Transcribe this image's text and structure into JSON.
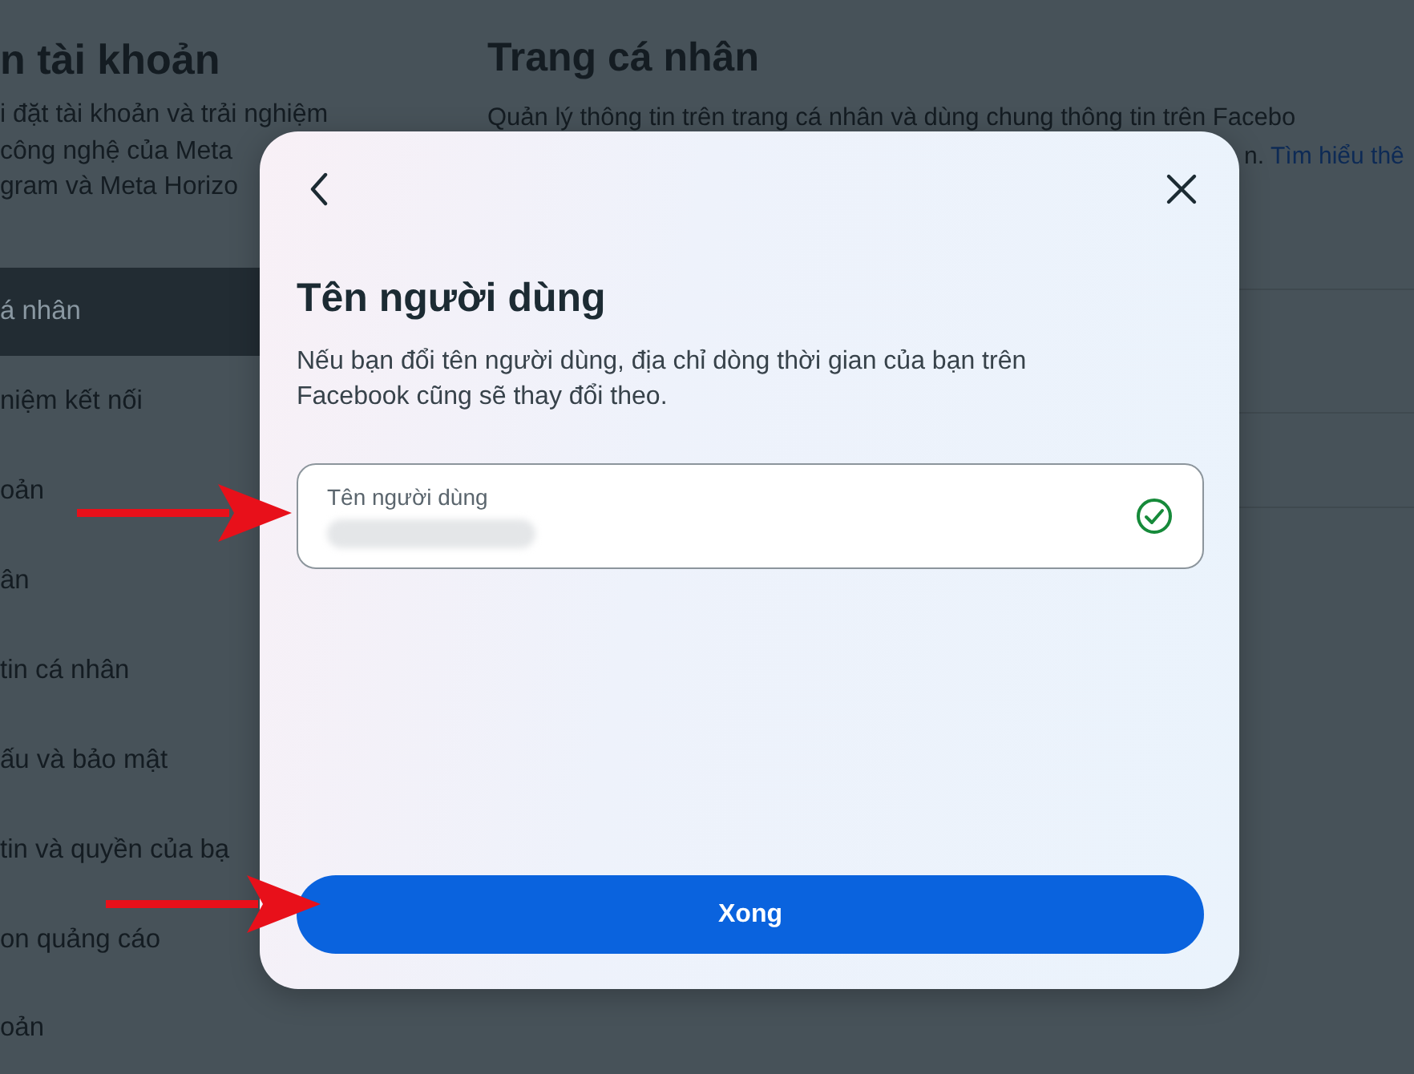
{
  "background": {
    "sidebar": {
      "title": "n tài khoản",
      "description_lines": [
        "i đặt tài khoản và trải nghiệm",
        "công nghệ của Meta",
        "gram và Meta Horizo"
      ],
      "items": [
        {
          "label": "á nhân",
          "selected": true
        },
        {
          "label": "niệm kết nối",
          "selected": false
        },
        {
          "label": "oản",
          "selected": false
        },
        {
          "label": "ân",
          "selected": false
        },
        {
          "label": "tin cá nhân",
          "selected": false
        },
        {
          "label": "ấu và bảo mật",
          "selected": false
        },
        {
          "label": "tin và quyền của bạ",
          "selected": false
        },
        {
          "label": "on quảng cáo",
          "selected": false
        },
        {
          "label": "oản",
          "selected": false
        }
      ]
    },
    "main": {
      "title": "Trang cá nhân",
      "description": "Quản lý thông tin trên trang cá nhân và dùng chung thông tin trên Facebo",
      "description_end": "n.",
      "link": "Tìm hiểu thê"
    }
  },
  "dialog": {
    "title": "Tên người dùng",
    "description": "Nếu bạn đổi tên người dùng, địa chỉ dòng thời gian của bạn trên Facebook cũng sẽ thay đổi theo.",
    "field": {
      "label": "Tên người dùng",
      "valid": true
    },
    "button": "Xong"
  }
}
